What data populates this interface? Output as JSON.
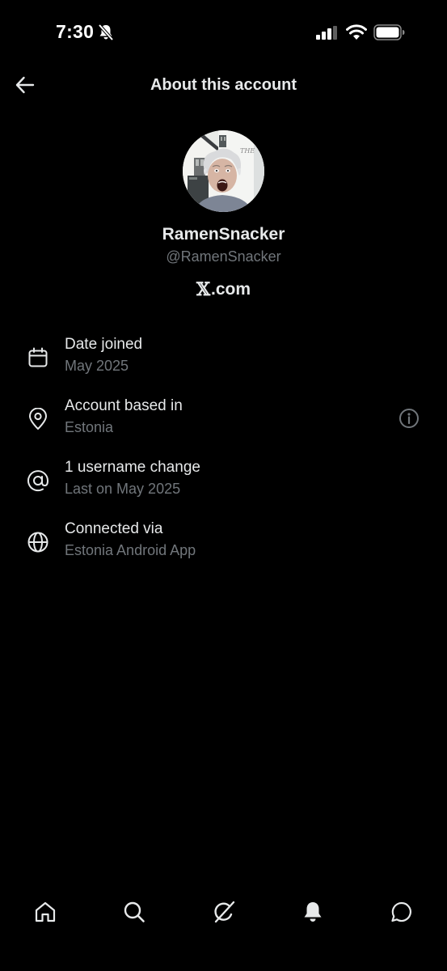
{
  "status_bar": {
    "time": "7:30",
    "icons": [
      "bell-slash-icon",
      "signal-icon",
      "wifi-icon",
      "battery-icon"
    ]
  },
  "header": {
    "title": "About this account",
    "back_icon": "arrow-left-icon"
  },
  "profile": {
    "display_name": "RamenSnacker",
    "handle": "@RamenSnacker",
    "platform_x": "𝕏",
    "platform_domain": ".com"
  },
  "info": {
    "date_joined": {
      "icon": "calendar-icon",
      "label": "Date joined",
      "value": "May 2025"
    },
    "account_based_in": {
      "icon": "location-pin-icon",
      "label": "Account based in",
      "value": "Estonia",
      "action_icon": "info-circle-icon"
    },
    "username_change": {
      "icon": "at-sign-icon",
      "label": "1 username change",
      "value": "Last on May 2025"
    },
    "connected_via": {
      "icon": "globe-icon",
      "label": "Connected via",
      "value": "Estonia Android App"
    }
  },
  "bottom_nav": {
    "items": [
      "home-icon",
      "search-icon",
      "grok-icon",
      "notifications-bell-icon",
      "messages-icon"
    ],
    "active": "notifications-bell-icon"
  },
  "colors": {
    "background": "#000000",
    "primary_text": "#e7e9ea",
    "secondary_text": "#71767b"
  }
}
